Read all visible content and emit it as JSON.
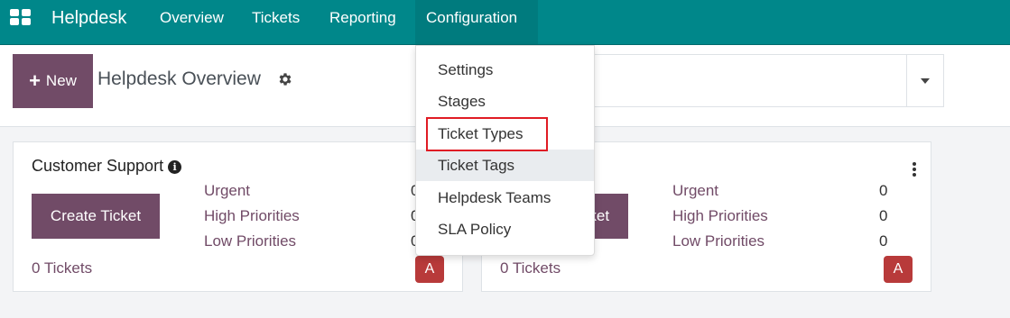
{
  "navbar": {
    "brand": "Helpdesk",
    "menu": [
      {
        "label": "Overview"
      },
      {
        "label": "Tickets"
      },
      {
        "label": "Reporting"
      },
      {
        "label": "Configuration",
        "active": true
      }
    ],
    "color": "#00878a"
  },
  "control_panel": {
    "new_button_label": "New",
    "page_title": "Helpdesk Overview",
    "icons": [
      "plus-icon",
      "gear-icon",
      "caret-down-icon"
    ]
  },
  "config_dropdown": {
    "items": [
      {
        "label": "Settings"
      },
      {
        "label": "Stages"
      },
      {
        "label": "Ticket Types",
        "highlighted": true
      },
      {
        "label": "Ticket Tags",
        "hovered": true
      },
      {
        "label": "Helpdesk Teams"
      },
      {
        "label": "SLA Policy"
      }
    ]
  },
  "cards": [
    {
      "title": "Customer Support",
      "create_label": "Create Ticket",
      "stats": [
        {
          "label": "Urgent",
          "count": "0"
        },
        {
          "label": "High Priorities",
          "count": "0"
        },
        {
          "label": "Low Priorities",
          "count": "0"
        }
      ],
      "tickets_label": "0 Tickets",
      "avatar_initial": "A"
    },
    {
      "create_label": "Create Ticket",
      "stats": [
        {
          "label": "Urgent",
          "count": "0"
        },
        {
          "label": "High Priorities",
          "count": "0"
        },
        {
          "label": "Low Priorities",
          "count": "0"
        }
      ],
      "tickets_label": "0 Tickets",
      "avatar_initial": "A"
    }
  ],
  "colors": {
    "brand_teal": "#00878a",
    "primary_purple": "#714b67",
    "avatar_red": "#b83a3a",
    "highlight_red": "#e01b24"
  }
}
